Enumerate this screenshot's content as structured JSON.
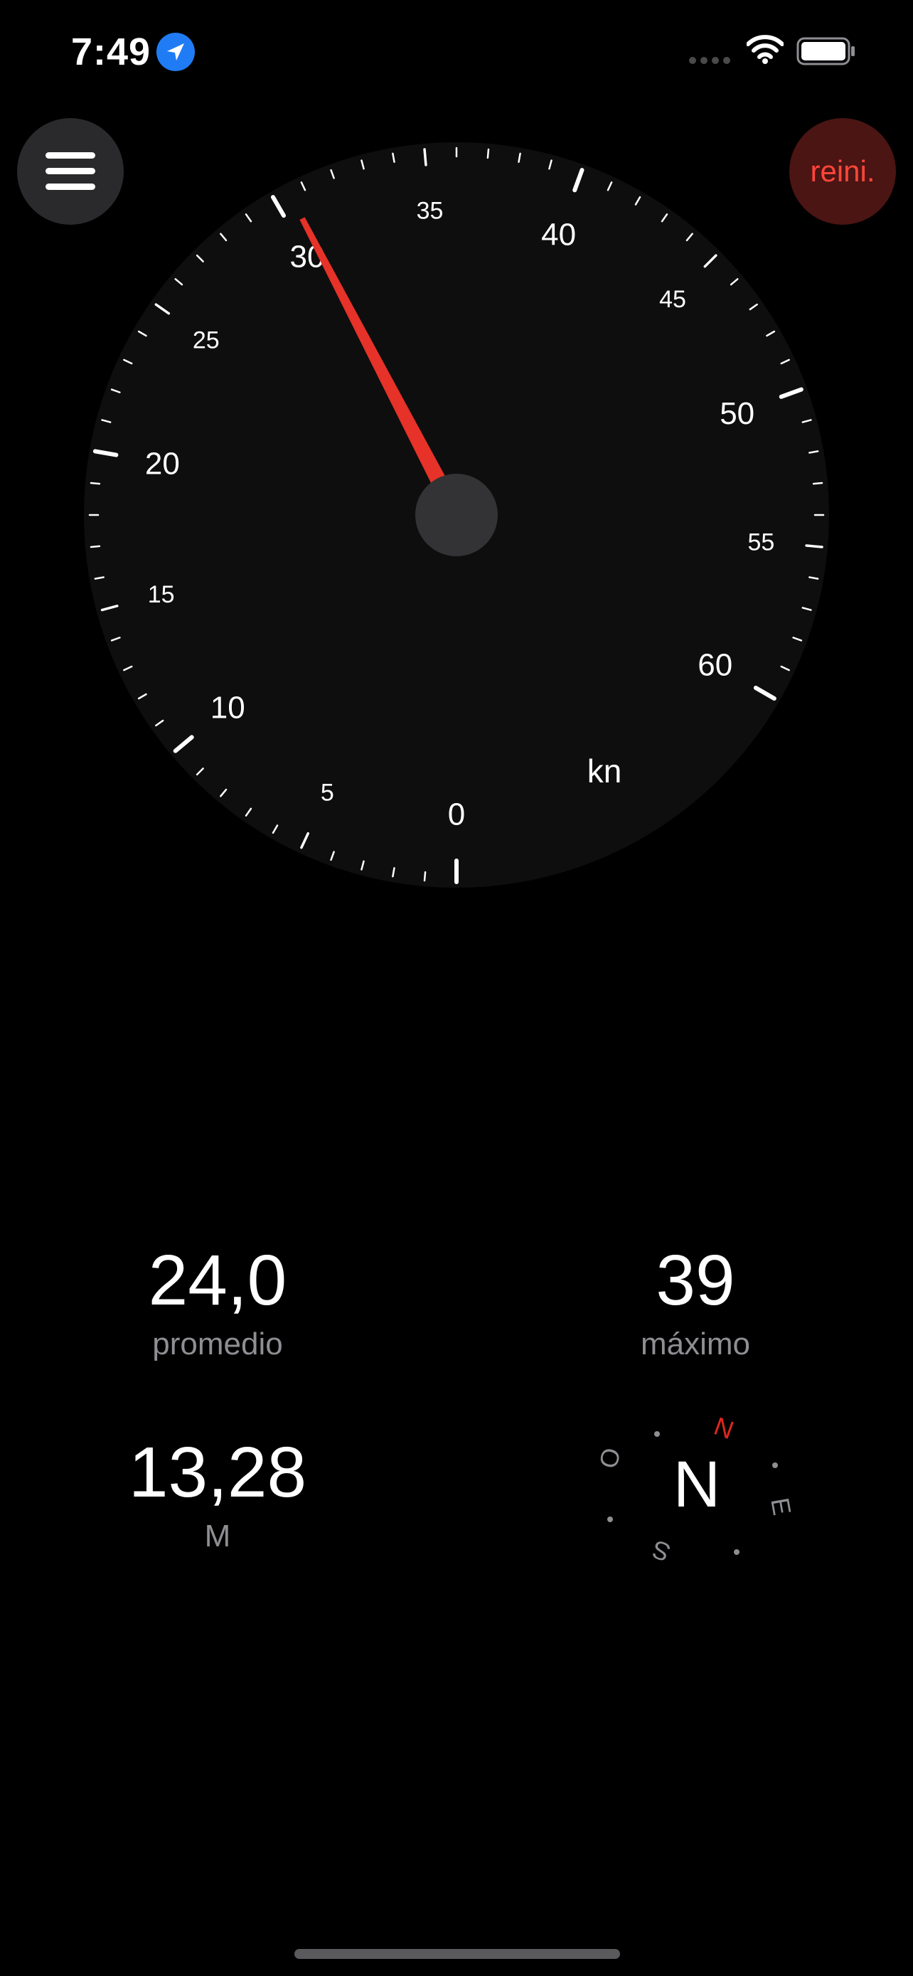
{
  "status_bar": {
    "time": "7:49",
    "location_icon": "location-arrow-icon",
    "signal_icon": "cellular-signal-icon",
    "wifi_icon": "wifi-icon",
    "battery_icon": "battery-full-icon"
  },
  "toolbar": {
    "menu_icon": "hamburger-menu-icon",
    "reset_label": "reini."
  },
  "gauge": {
    "unit": "kn",
    "min": 0,
    "max": 60,
    "current_speed": 30.5,
    "major_labels": [
      "0",
      "10",
      "20",
      "30",
      "40",
      "50",
      "60"
    ],
    "minor_labels": [
      "5",
      "15",
      "25",
      "35",
      "45",
      "55"
    ],
    "colors": {
      "dial": "#0e0e0e",
      "needle": "#e63228",
      "hub": "#333335",
      "tick": "#ffffff"
    }
  },
  "stats": {
    "average_value": "24,0",
    "average_label": "promedio",
    "max_value": "39",
    "max_label": "máximo",
    "distance_value": "13,28",
    "distance_unit": "M"
  },
  "compass": {
    "heading": "N",
    "north_marker": "N",
    "east": "E",
    "south": "S",
    "west": "O",
    "north_color": "#e0261d"
  }
}
